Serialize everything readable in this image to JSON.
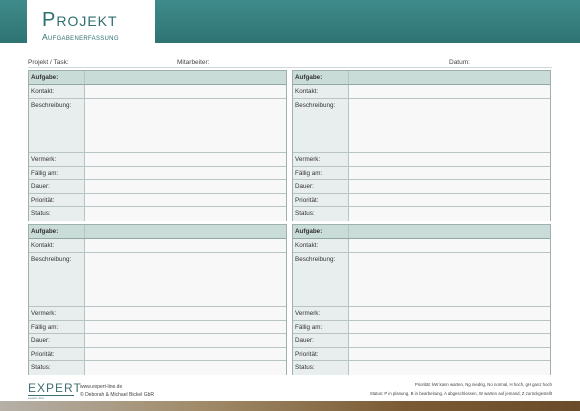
{
  "header": {
    "title": "Projekt",
    "subtitle": "Aufgabenerfassung",
    "colors": {
      "bar": "#3a8282",
      "title": "#2e6f6f"
    }
  },
  "meta": {
    "project_label": "Projekt / Task:",
    "employee_label": "Mitarbeiter:",
    "date_label": "Datum:"
  },
  "card_labels": {
    "task": "Aufgabe:",
    "contact": "Kontakt:",
    "description": "Beschreibung:",
    "note": "Vermerk:",
    "due": "Fällig am:",
    "duration": "Dauer:",
    "priority": "Priorität:",
    "status": "Status:"
  },
  "footer": {
    "logo": "EXPERT",
    "logo_sub": "expert-line",
    "website": "www.expert-line.de",
    "copyright": "© Deborah & Michael Bickel GbR",
    "priority_legend": "Priorität: kW kann warten, Ng niedrig, No normal, H hoch, gH ganz hoch",
    "status_legend": "Status: P in planung, B in bearbeitung, A abgeschlossen, W warten auf jemand, Z zurückgestellt"
  }
}
